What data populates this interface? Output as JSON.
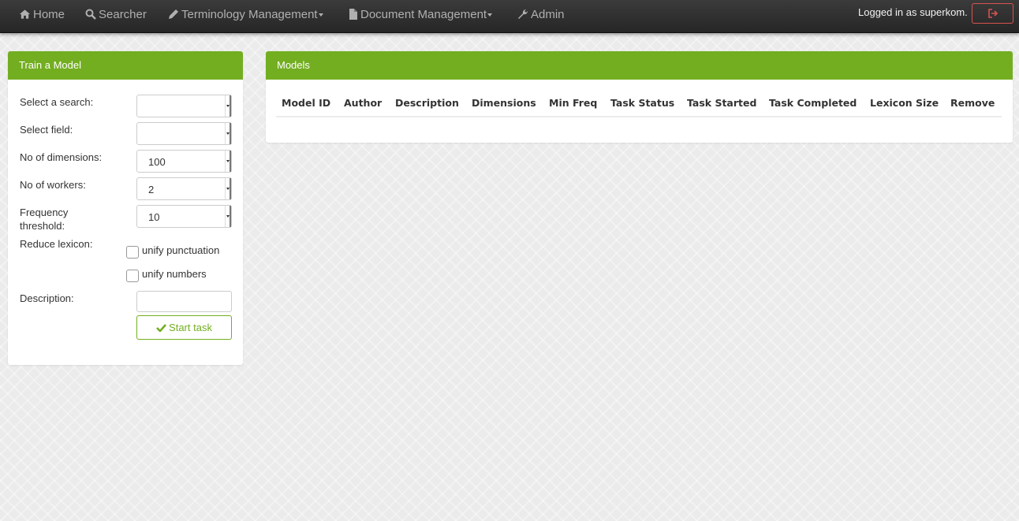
{
  "navbar": {
    "items": [
      {
        "label": "Home",
        "icon": "home-icon"
      },
      {
        "label": "Searcher",
        "icon": "search-icon"
      },
      {
        "label": "Terminology Management",
        "icon": "pencil-icon",
        "dropdown": true
      },
      {
        "label": "Document Management",
        "icon": "file-icon",
        "dropdown": true
      },
      {
        "label": "Admin",
        "icon": "wrench-icon"
      }
    ],
    "logged_in_text": "Logged in as superkom.",
    "logout_icon": "sign-out-icon"
  },
  "train_panel": {
    "title": "Train a Model",
    "fields": {
      "search_label": "Select a search:",
      "search_value": "",
      "field_label": "Select field:",
      "field_value": "",
      "dimensions_label": "No of dimensions:",
      "dimensions_value": "100",
      "workers_label": "No of workers:",
      "workers_value": "2",
      "frequency_label_line1": "Frequency",
      "frequency_label_line2": "threshold:",
      "frequency_value": "10",
      "reduce_label": "Reduce lexicon:",
      "unify_punctuation": "unify punctuation",
      "unify_numbers": "unify numbers",
      "description_label": "Description:",
      "description_value": ""
    },
    "start_button": "Start task"
  },
  "models_panel": {
    "title": "Models",
    "columns": [
      "Model ID",
      "Author",
      "Description",
      "Dimensions",
      "Min Freq",
      "Task Status",
      "Task Started",
      "Task Completed",
      "Lexicon Size",
      "Remove"
    ],
    "rows": []
  },
  "colors": {
    "accent": "#73ae21",
    "navbar": "#2e2e2e",
    "logout": "#d9534f"
  }
}
